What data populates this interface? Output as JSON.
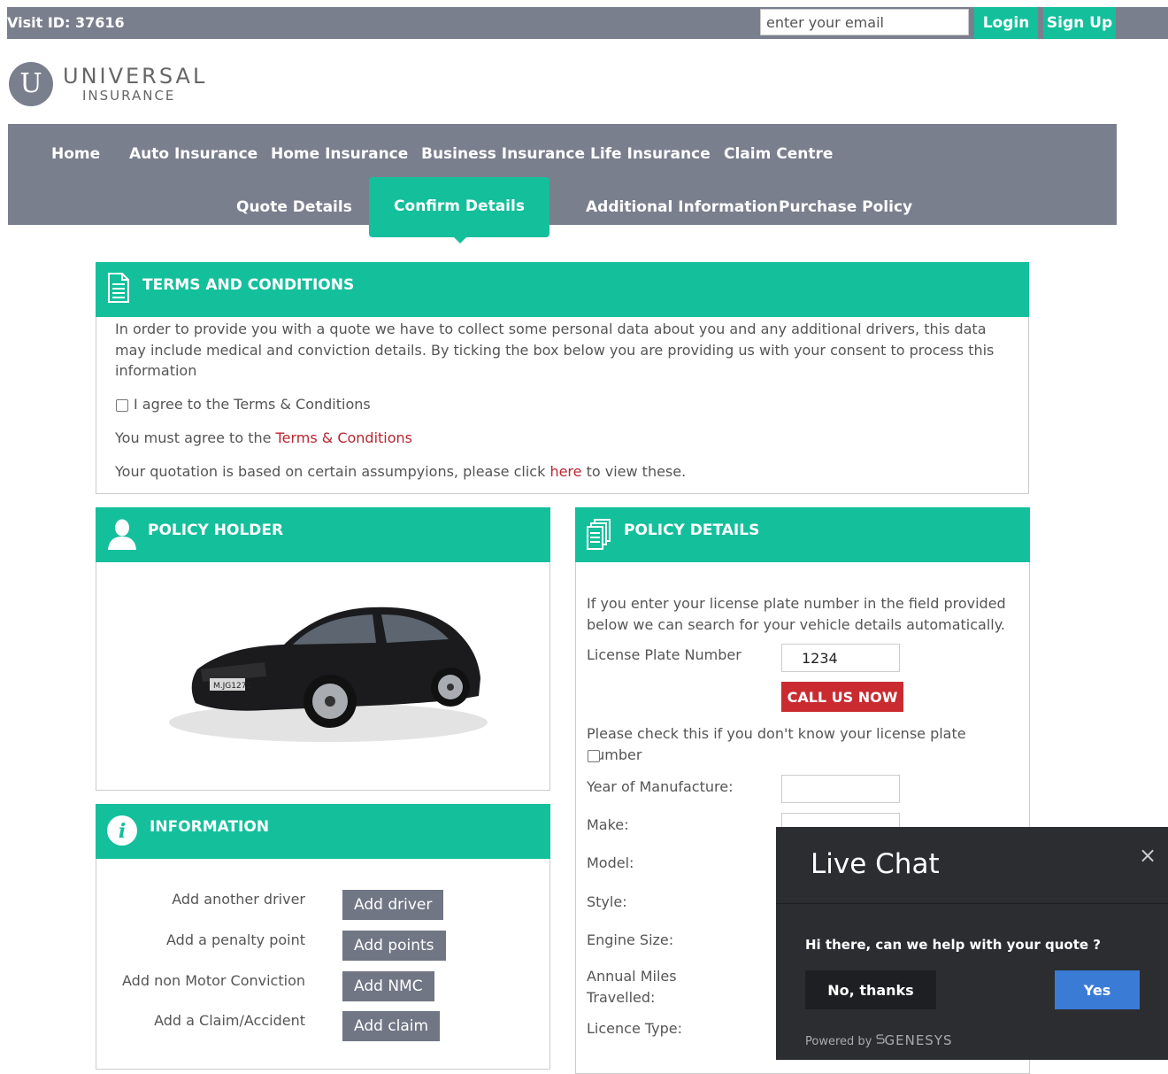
{
  "topbar": {
    "visit_id": "Visit ID: 37616",
    "email_placeholder": "enter your email",
    "login_label": "Login",
    "signup_label": "Sign Up"
  },
  "logo": {
    "letter": "U",
    "name": "UNIVERSAL",
    "sub": "INSURANCE"
  },
  "nav": {
    "main": [
      "Home",
      "Auto Insurance",
      "Home Insurance",
      "Business Insurance",
      "Life Insurance",
      "Claim Centre"
    ],
    "steps": [
      "Quote Details",
      "Confirm Details",
      "Additional Information",
      "Purchase Policy"
    ],
    "active_step": "Confirm Details"
  },
  "terms": {
    "title": "TERMS AND CONDITIONS",
    "body": "In order to provide you with a quote we have to collect some personal data about you and any additional drivers, this data may include medical and conviction details. By ticking the box below you are providing us with your consent to process this information",
    "agree_label": "I agree to the Terms & Conditions",
    "must_agree": "You must agree to the ",
    "must_agree_link": "Terms & Conditions",
    "quote_based": "Your quotation is based on certain assumpyions, please click ",
    "here_link": "here",
    "quote_based_end": " to view these."
  },
  "policy_holder": {
    "title": "POLICY HOLDER",
    "plate_text": "M.JG1272"
  },
  "information": {
    "title": "INFORMATION",
    "rows": [
      {
        "label": "Add another driver",
        "button": "Add driver"
      },
      {
        "label": "Add a penalty point",
        "button": "Add points"
      },
      {
        "label": "Add non Motor Conviction",
        "button": "Add NMC"
      },
      {
        "label": "Add a Claim/Accident",
        "button": "Add claim"
      }
    ]
  },
  "policy_details": {
    "title": "POLICY DETAILS",
    "intro": "If you enter your license plate number in the field provided below we can search for your vehicle details automatically.",
    "plate_label": "License Plate Number",
    "plate_value": "1234",
    "call_label": "CALL US NOW",
    "dont_know": "Please check this if you don't know your license plate number",
    "year_label": "Year of Manufacture:",
    "make_label": "Make:",
    "model_label": "Model:",
    "style_label": "Style:",
    "engine_label": "Engine Size:",
    "annual_label": "Annual Miles Travelled:",
    "licence_label": "Licence Type:"
  },
  "chat": {
    "title": "Live Chat",
    "close": "×",
    "question": "Hi there, can we help with your quote ?",
    "no_label": "No, thanks",
    "yes_label": "Yes",
    "powered": "Powered by",
    "brand": "GENESYS"
  }
}
